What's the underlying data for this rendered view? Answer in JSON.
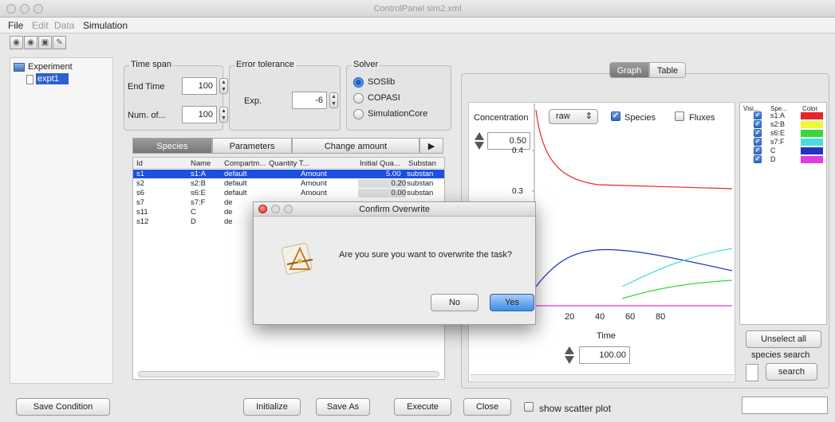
{
  "window": {
    "title": "ControlPanel sim2.xml"
  },
  "menu": [
    "File",
    "Edit",
    "Data",
    "Simulation"
  ],
  "tree": {
    "root": "Experiment",
    "child": "expt1"
  },
  "time_span": {
    "label": "Time span",
    "end_time_label": "End Time",
    "end_time": "100",
    "num_label": "Num. of...",
    "num": "100"
  },
  "error_tolerance": {
    "label": "Error tolerance",
    "exp_label": "Exp.",
    "exp": "-6"
  },
  "solver": {
    "label": "Solver",
    "options": [
      "SOSlib",
      "COPASI",
      "SimulationCore"
    ],
    "selected": "SOSlib"
  },
  "tabs": {
    "species": "Species",
    "parameters": "Parameters",
    "change_amount": "Change amount",
    "more": "▶"
  },
  "species_table": {
    "headers": [
      "Id",
      "Name",
      "Compartm...",
      "Quantity T...",
      "Initial Qua...",
      "Substan"
    ],
    "rows": [
      [
        "s1",
        "s1:A",
        "default",
        "Amount",
        "5.00",
        "substan"
      ],
      [
        "s2",
        "s2:B",
        "default",
        "Amount",
        "0.20",
        "substan"
      ],
      [
        "s6",
        "s6:E",
        "default",
        "Amount",
        "0.00",
        "substan"
      ],
      [
        "s7",
        "s7:F",
        "de",
        "",
        "",
        ""
      ],
      [
        "s11",
        "C",
        "de",
        "",
        "",
        ""
      ],
      [
        "s12",
        "D",
        "de",
        "",
        "",
        ""
      ]
    ]
  },
  "graph_tabs": {
    "graph": "Graph",
    "table": "Table"
  },
  "graph": {
    "concentration_label": "Concentration",
    "mode": "raw",
    "species_label": "Species",
    "fluxes_label": "Fluxes",
    "y_max_field": "0.50",
    "y_ticks": [
      "0.4",
      "0.3"
    ],
    "x_ticks": [
      "20",
      "40",
      "60",
      "80"
    ],
    "x_label": "Time",
    "x_max_field": "100.00"
  },
  "legend": {
    "headers": [
      "Visi...",
      "Spe...",
      "Color"
    ],
    "items": [
      {
        "name": "s1:A",
        "color": "#e8262a"
      },
      {
        "name": "s2:B",
        "color": "#f4f43c"
      },
      {
        "name": "s6:E",
        "color": "#37d837"
      },
      {
        "name": "s7:F",
        "color": "#49dcdc"
      },
      {
        "name": "C",
        "color": "#2333c8"
      },
      {
        "name": "D",
        "color": "#e23ae2"
      }
    ],
    "unselect_all": "Unselect all",
    "search_label": "species search",
    "search_button": "search"
  },
  "bottom": {
    "save_condition": "Save Condition",
    "initialize": "Initialize",
    "save_as": "Save As",
    "execute": "Execute",
    "close": "Close",
    "scatter": "show scatter plot"
  },
  "dialog": {
    "title": "Confirm Overwrite",
    "message": "Are you sure you want to overwrite the task?",
    "no": "No",
    "yes": "Yes"
  }
}
